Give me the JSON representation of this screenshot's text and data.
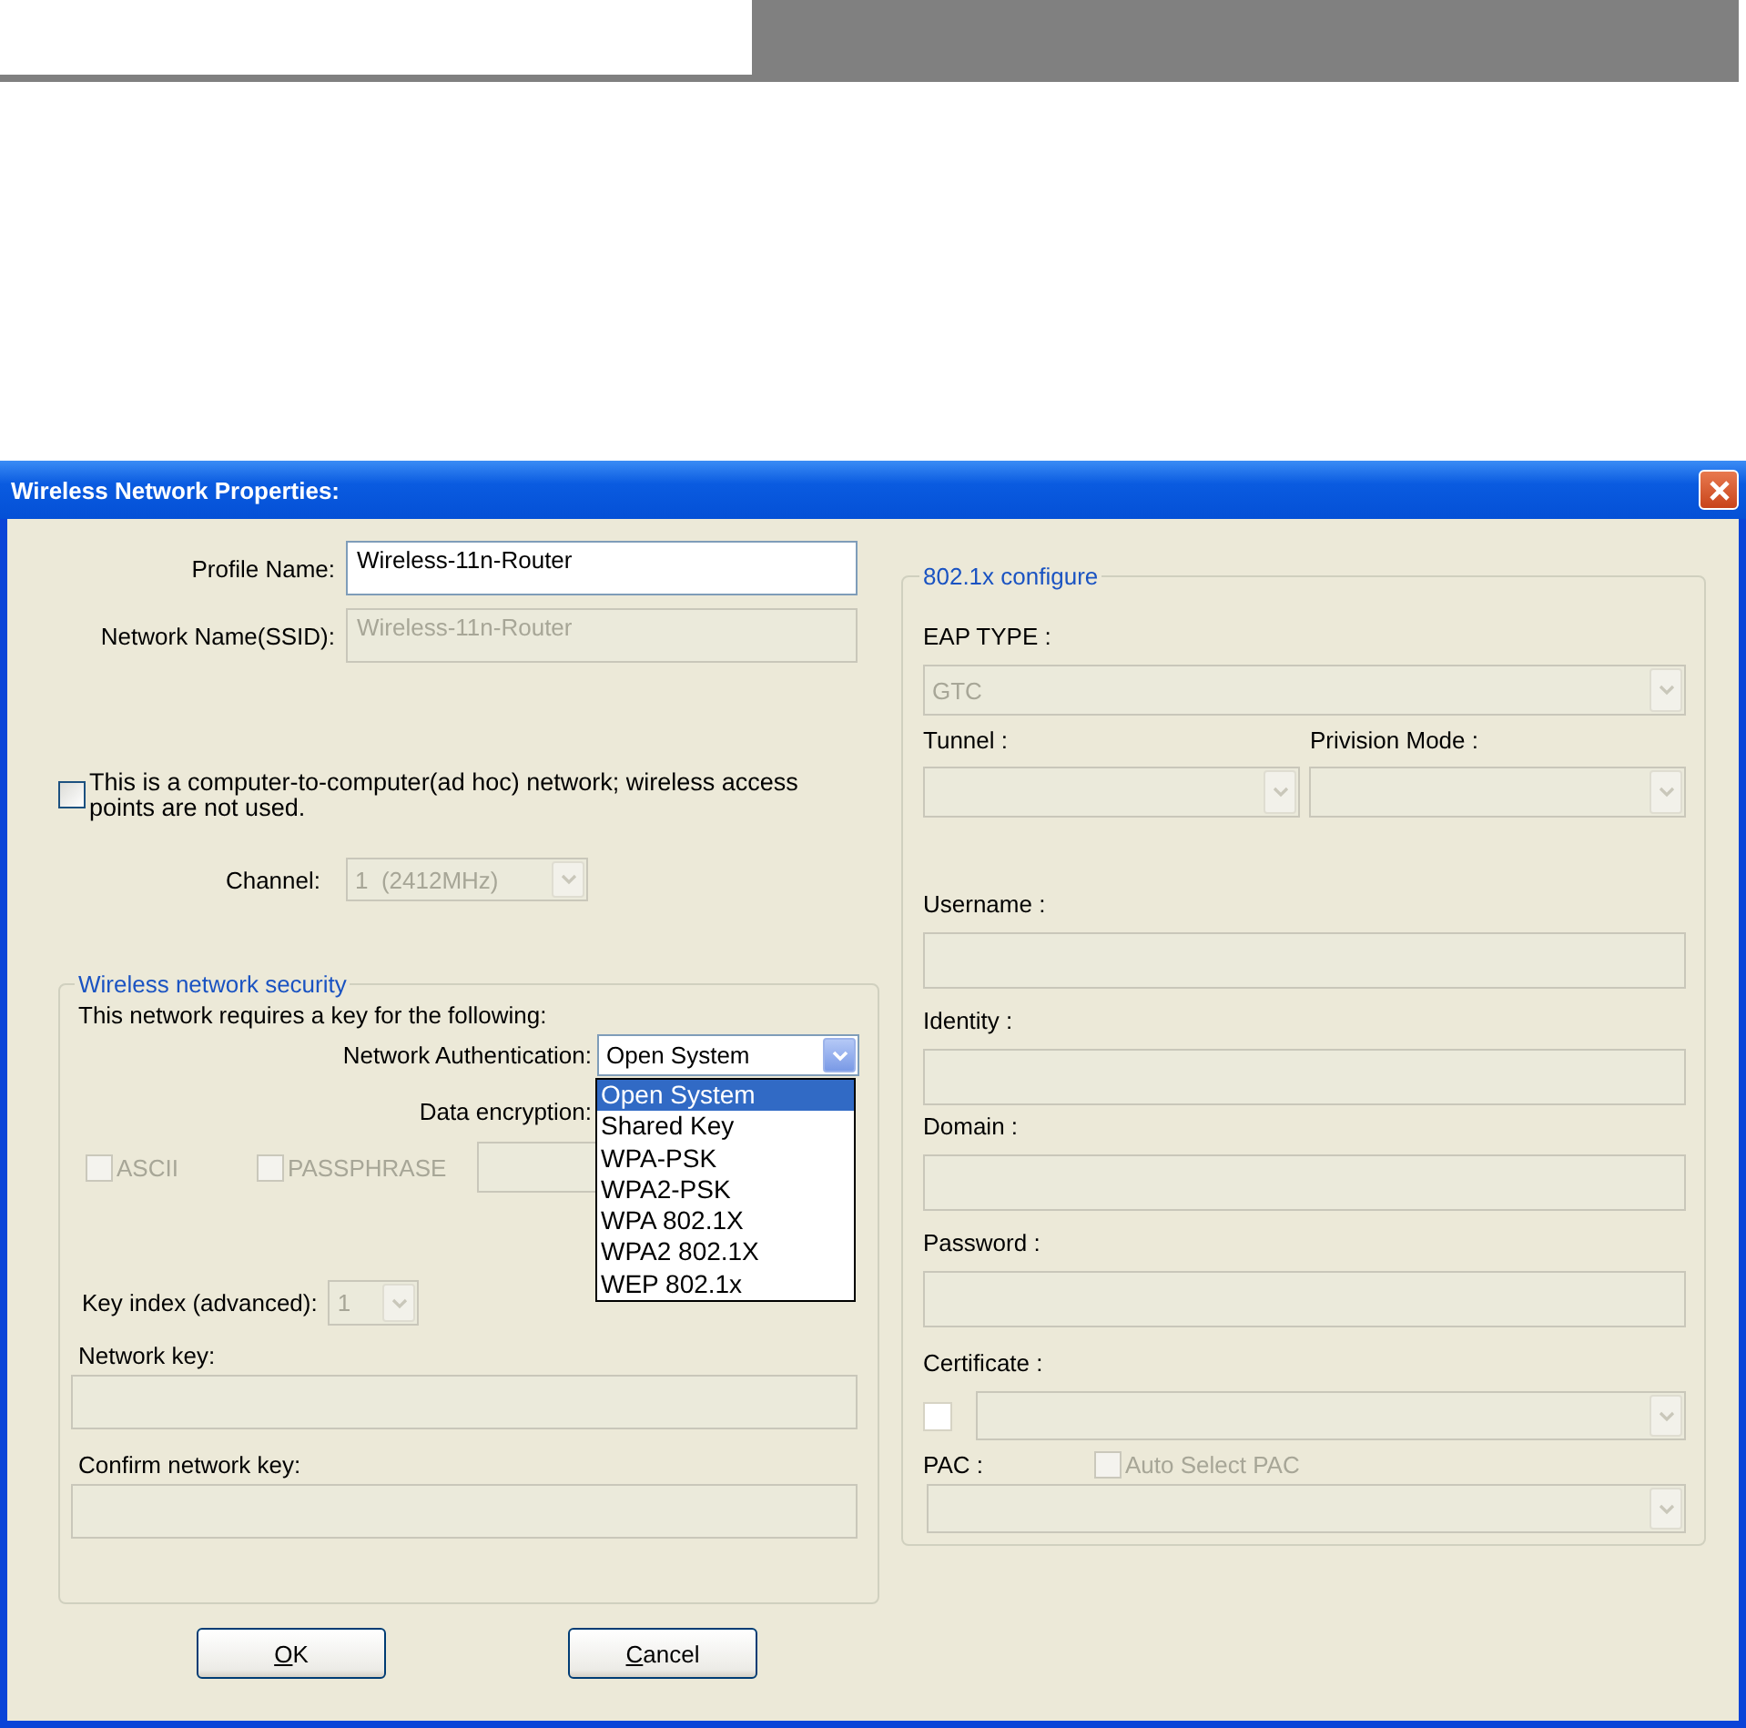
{
  "dialog": {
    "title": "Wireless Network Properties:"
  },
  "profile_name": {
    "label": "Profile Name:",
    "value": "Wireless-11n-Router",
    "disabled": false
  },
  "ssid": {
    "label": "Network Name(SSID):",
    "value": "Wireless-11n-Router",
    "disabled": true
  },
  "adhoc": {
    "label": "This is a computer-to-computer(ad hoc) network; wireless access points are not used.",
    "checked": false
  },
  "channel": {
    "label": "Channel:",
    "value": "1  (2412MHz)",
    "disabled": true
  },
  "security": {
    "legend": "Wireless network security",
    "intro": "This network requires a key for the following:",
    "authentication": {
      "label": "Network Authentication:",
      "value": "Open System",
      "disabled": false,
      "expanded": true,
      "options": [
        {
          "label": "Open System",
          "selected": true
        },
        {
          "label": "Shared Key",
          "selected": false
        },
        {
          "label": "WPA-PSK",
          "selected": false
        },
        {
          "label": "WPA2-PSK",
          "selected": false
        },
        {
          "label": "WPA 802.1X",
          "selected": false
        },
        {
          "label": "WPA2 802.1X",
          "selected": false
        },
        {
          "label": "WEP 802.1x",
          "selected": false
        }
      ]
    },
    "encryption": {
      "label": "Data encryption:"
    },
    "ascii": {
      "label": "ASCII",
      "checked": false,
      "disabled": true
    },
    "passphrase": {
      "label": "PASSPHRASE",
      "checked": false,
      "disabled": true
    },
    "key_index": {
      "label": "Key index (advanced):",
      "value": "1",
      "disabled": true
    },
    "network_key": {
      "label": "Network key:",
      "disabled": true
    },
    "confirm_key": {
      "label": "Confirm network key:",
      "disabled": true
    }
  },
  "config": {
    "legend": "802.1x configure",
    "eap_type": {
      "label": "EAP TYPE :",
      "value": "GTC",
      "disabled": true
    },
    "tunnel": {
      "label": "Tunnel :",
      "disabled": true
    },
    "provision_mode": {
      "label": "Privision Mode :",
      "disabled": true
    },
    "username": {
      "label": "Username :",
      "disabled": true
    },
    "identity": {
      "label": "Identity :",
      "disabled": true
    },
    "domain": {
      "label": "Domain :",
      "disabled": true
    },
    "password": {
      "label": "Password :",
      "disabled": true
    },
    "certificate": {
      "label": "Certificate :",
      "checked": false,
      "disabled": true
    },
    "pac": {
      "label": "PAC :",
      "disabled": true
    },
    "auto_select_pac": {
      "label": "Auto Select PAC",
      "checked": false,
      "disabled": true
    }
  },
  "buttons": [
    {
      "accel": "O",
      "rest": "K"
    },
    {
      "accel": "C",
      "rest": "ancel"
    }
  ]
}
